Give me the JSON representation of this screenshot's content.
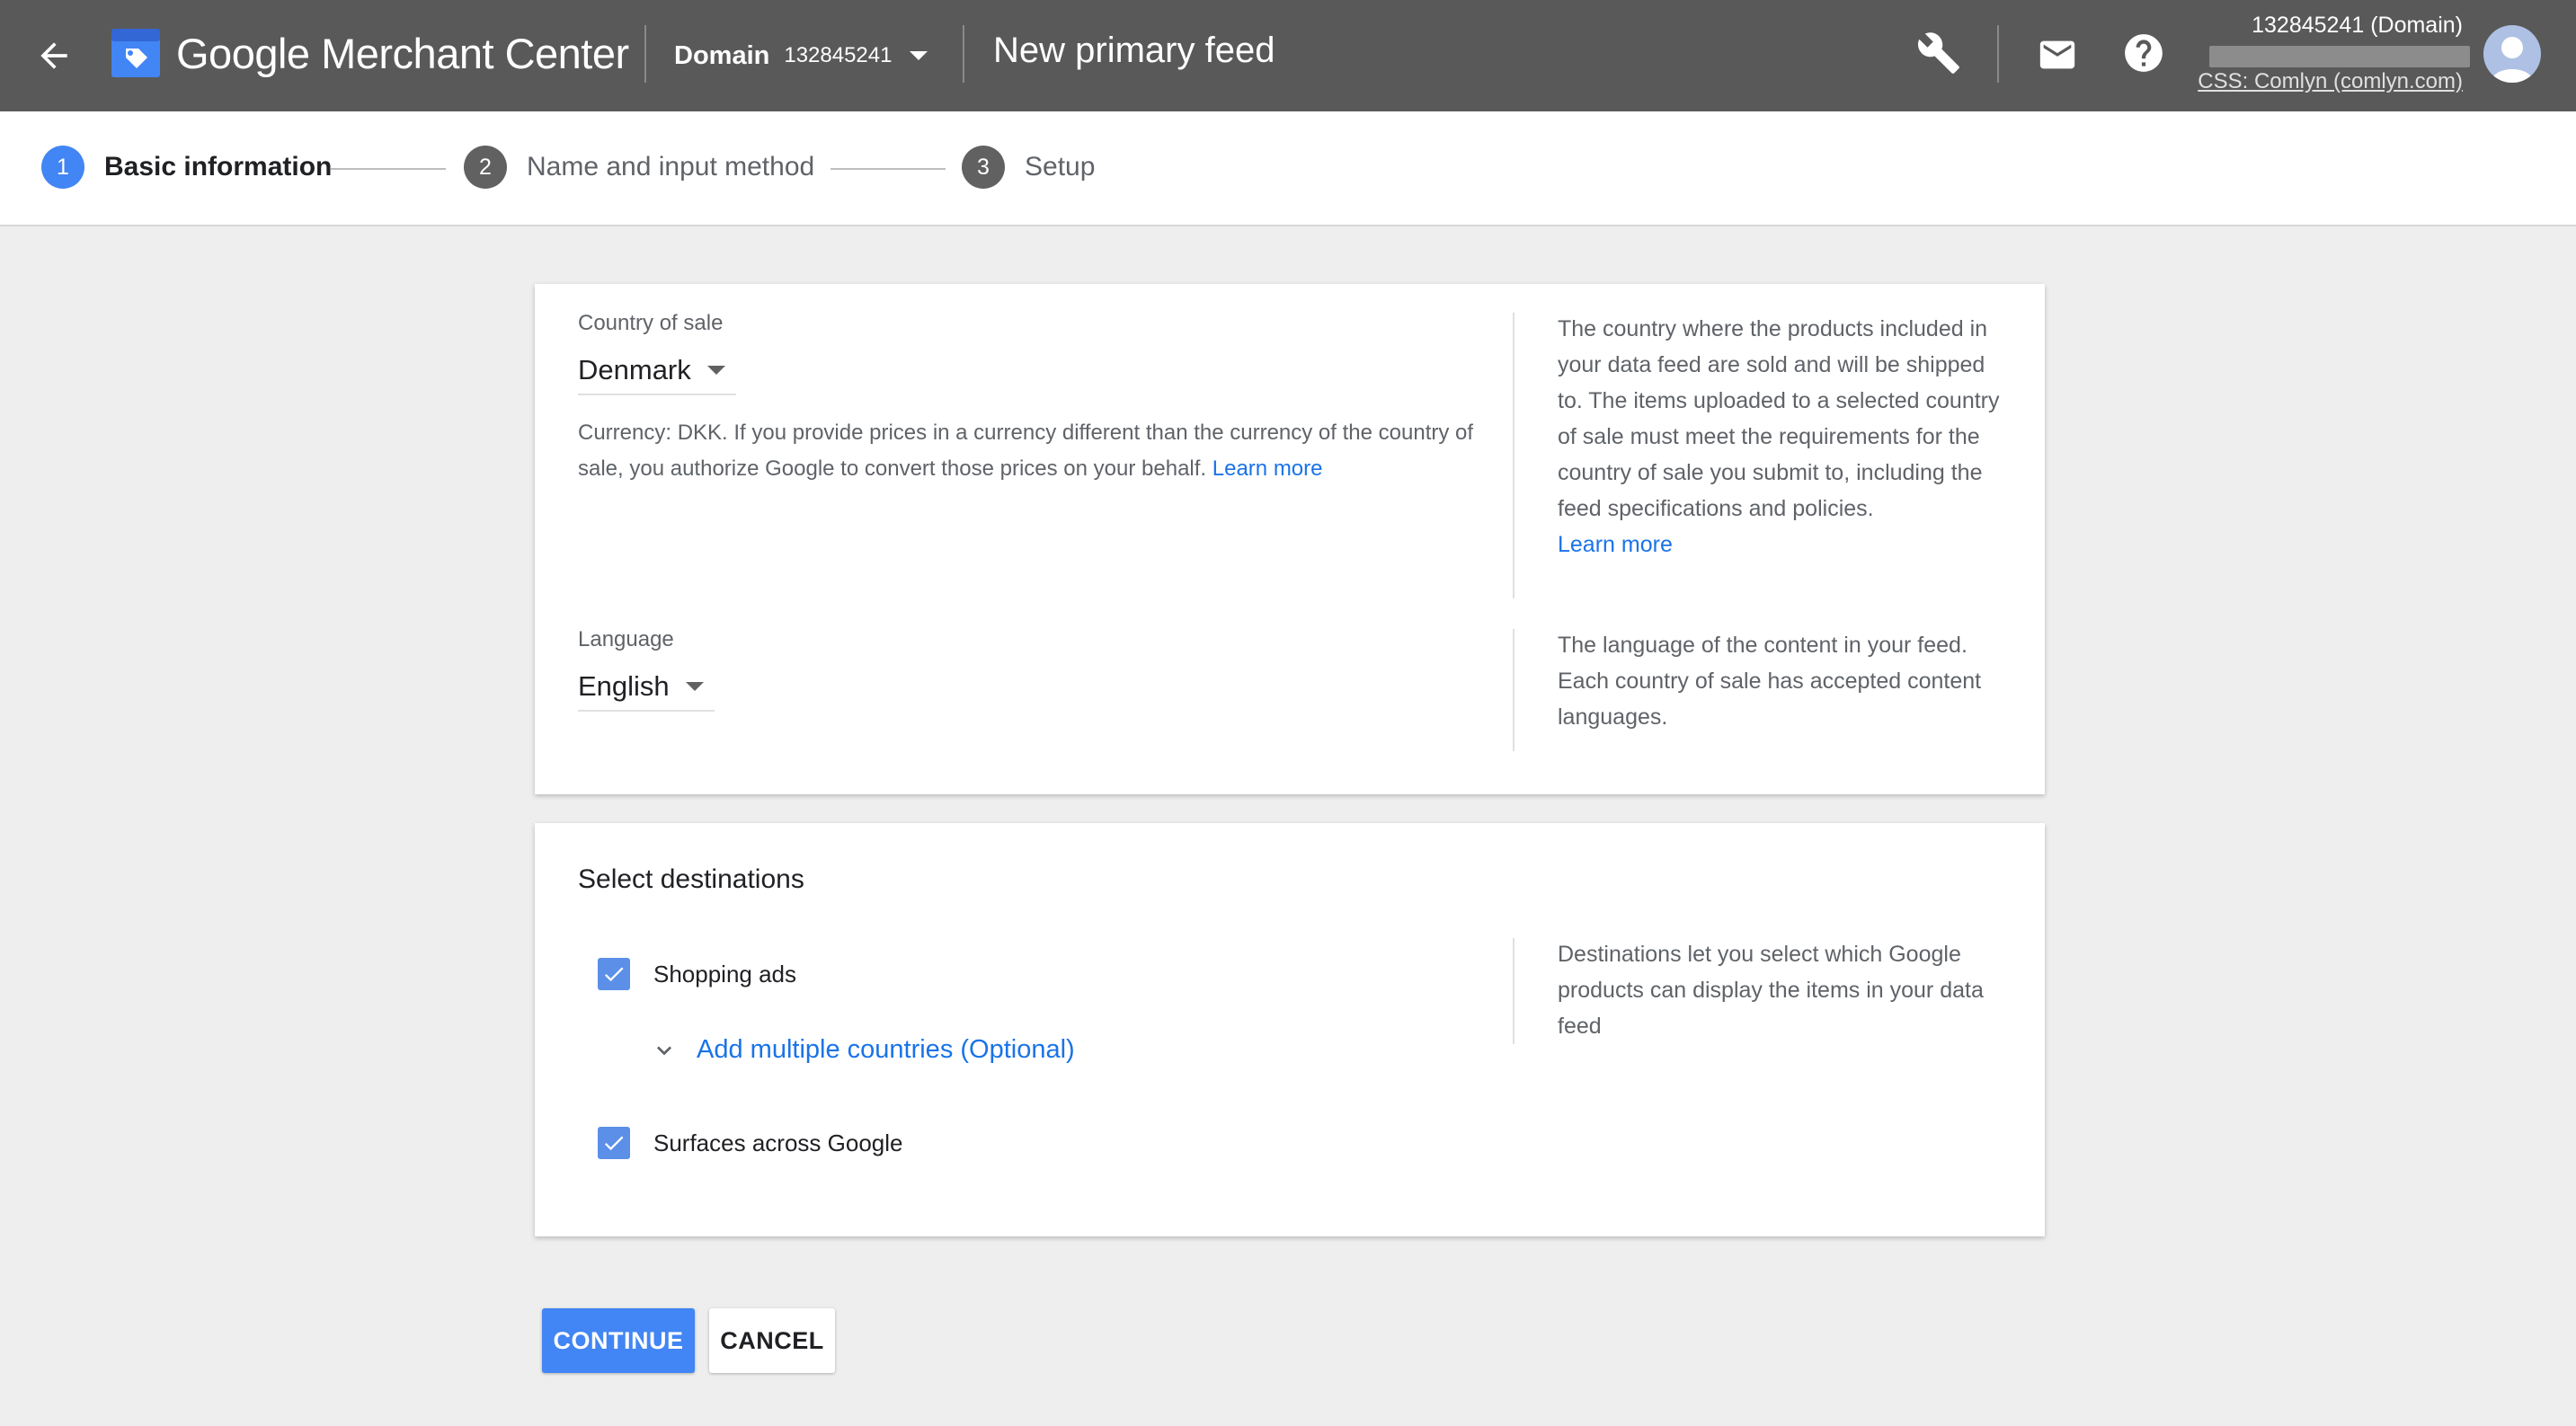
{
  "header": {
    "app_name": "Google Merchant Center",
    "account_type": "Domain",
    "account_id": "132845241",
    "page_title": "New primary feed",
    "account_name": "132845241 (Domain)",
    "css_link": "CSS: Comlyn (comlyn.com)",
    "icons": [
      "back-arrow-icon",
      "merchant-center-logo-icon",
      "wrench-icon",
      "mail-icon",
      "help-icon",
      "avatar-icon"
    ]
  },
  "stepper": {
    "steps": [
      {
        "number": "1",
        "label": "Basic information"
      },
      {
        "number": "2",
        "label": "Name and input method"
      },
      {
        "number": "3",
        "label": "Setup"
      }
    ]
  },
  "basic_info": {
    "country": {
      "label": "Country of sale",
      "value": "Denmark",
      "helper": "Currency: DKK. If you provide prices in a currency different than the currency of the country of sale, you authorize Google to convert those prices on your behalf.",
      "helper_link": "Learn more",
      "side_text": "The country where the products included in your data feed are sold and will be shipped to. The items uploaded to a selected country of sale must meet the requirements for the country of sale you submit to, including the feed specifications and policies.",
      "side_link": "Learn more"
    },
    "language": {
      "label": "Language",
      "value": "English",
      "side_text": "The language of the content in your feed. Each country of sale has accepted content languages."
    }
  },
  "destinations": {
    "title": "Select destinations",
    "shopping_ads": "Shopping ads",
    "add_countries": "Add multiple countries (Optional)",
    "surfaces": "Surfaces across Google",
    "side_text": "Destinations let you select which Google products can display the items in your data feed"
  },
  "actions": {
    "continue": "CONTINUE",
    "cancel": "CANCEL"
  },
  "colors": {
    "header_bg": "#595959",
    "accent": "#4285f4",
    "link": "#1a73e8",
    "page_bg": "#eeeeee"
  }
}
